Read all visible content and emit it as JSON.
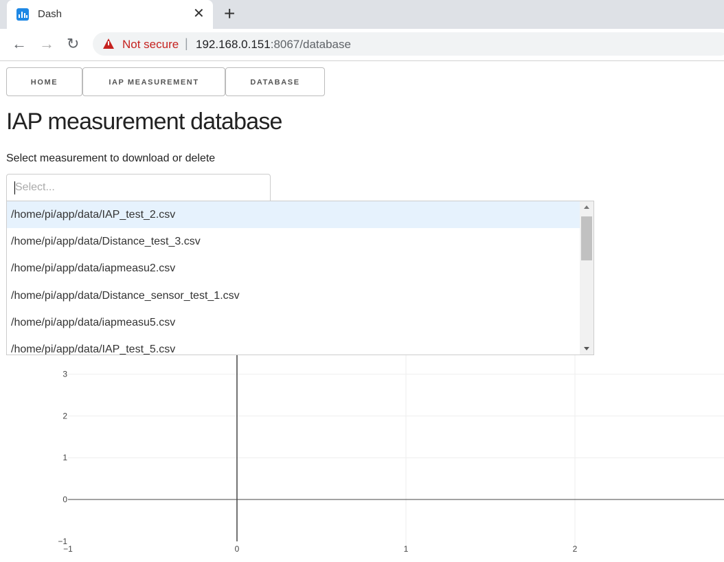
{
  "browser": {
    "tab_title": "Dash",
    "close_glyph": "✕",
    "newtab_glyph": "+",
    "back_glyph": "←",
    "forward_glyph": "→",
    "reload_glyph": "↻",
    "not_secure": "Not secure",
    "url_host": "192.168.0.151",
    "url_path": ":8067/database"
  },
  "nav": {
    "home": "HOME",
    "iap": "IAP MEASUREMENT",
    "database": "DATABASE"
  },
  "page": {
    "title": "IAP measurement database",
    "select_label": "Select measurement to download or delete",
    "placeholder": "Select..."
  },
  "dropdown_options": [
    "/home/pi/app/data/IAP_test_2.csv",
    "/home/pi/app/data/Distance_test_3.csv",
    "/home/pi/app/data/iapmeasu2.csv",
    "/home/pi/app/data/Distance_sensor_test_1.csv",
    "/home/pi/app/data/iapmeasu5.csv",
    "/home/pi/app/data/IAP_test_5.csv"
  ],
  "graph": {
    "x_ticks": [
      "−1",
      "0",
      "1",
      "2"
    ],
    "y_ticks": [
      "3",
      "2",
      "1",
      "0",
      "−1"
    ],
    "xlim": [
      -1,
      3
    ],
    "ylim": [
      -1,
      3.3
    ]
  },
  "colors": {
    "accent": "#1e88e5",
    "warning": "#c5221f",
    "hover": "#e6f2fd"
  }
}
